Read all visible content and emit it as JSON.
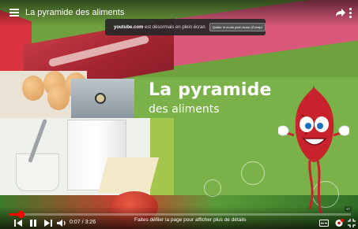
{
  "player": {
    "video_title": "La pyramide des aliments",
    "toast": {
      "domain": "youtube.com",
      "message": " est désormais en plein écran",
      "exit_button_label": "Quitter le mode plein écran (Échap)"
    },
    "controls": {
      "current_time": "0:07",
      "duration": "3:26",
      "time_separator": " / ",
      "progress_fraction": 0.034,
      "scroll_hint": "Faites défiler la page pour afficher plus de détails",
      "watermark": "YT"
    }
  },
  "slide": {
    "title": "La pyramide",
    "subtitle": "des aliments"
  },
  "colors": {
    "progress": "#ff0000",
    "slide_green": "#7ab249"
  },
  "icons": [
    "menu-icon",
    "share-icon",
    "more-icon",
    "lock-icon",
    "prev-icon",
    "pause-icon",
    "next-icon",
    "volume-icon",
    "subtitles-icon",
    "settings-icon",
    "fullscreen-exit-icon"
  ]
}
